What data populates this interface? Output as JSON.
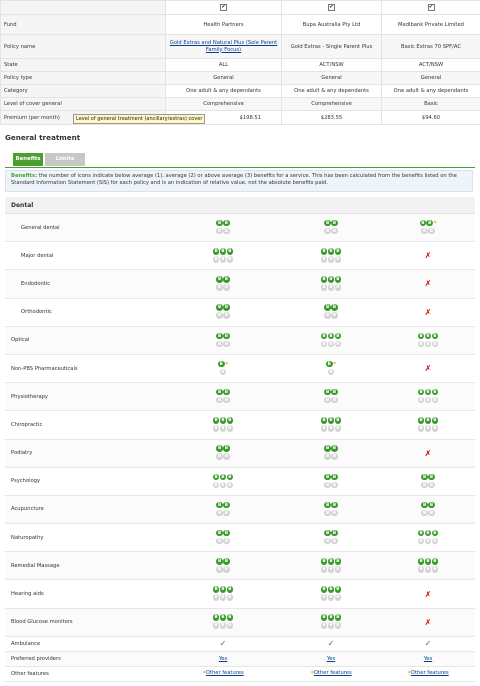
{
  "compare": {
    "select_marks": [
      "✔",
      "✔",
      "✔"
    ],
    "rows": [
      {
        "label": "Fund",
        "values": [
          "Health Partners",
          "Bupa Australia Pty Ltd",
          "Medibank Private Limited"
        ]
      },
      {
        "label": "Policy name",
        "values": [
          "Gold Extras and Natural Plus (Sole Parent Family Focus)",
          "Gold Extras - Single Parent Plus",
          "Basic Extras 70 SPF/AC"
        ]
      },
      {
        "label": "State",
        "values": [
          "ALL",
          "ACT/NSW",
          "ACT/NSW"
        ]
      },
      {
        "label": "Policy type",
        "values": [
          "General",
          "General",
          "General"
        ]
      },
      {
        "label": "Category",
        "values": [
          "One adult & any dependants",
          "One adult & any dependants",
          "One adult & any dependants"
        ]
      },
      {
        "label": "Level of cover general",
        "values": [
          "Comprehensive",
          "Comprehensive",
          "Basic"
        ]
      },
      {
        "label": "Premium (per month)",
        "values": [
          "$198.51",
          "$283.55",
          "$94.60"
        ]
      }
    ]
  },
  "tooltip": "Level of general treatment (ancillary/extras) cover",
  "section_title": "General treatment",
  "tabs": {
    "benefits": "Benefits",
    "limits": "Limits"
  },
  "info": {
    "label": "Benefits:",
    "text": " the number of icons indicate below average (1), average (2) or above average (3) benefits for a service. This has been calculated from the benefits listed on the Standard Information Statement (SIS) for each policy and is an indication of relative value, not the absolute benefits paid."
  },
  "dental_heading": "Dental",
  "icon_letter": "B",
  "cross_symbol": "✗",
  "tick_symbol": "✓",
  "star_symbol": "*",
  "services": [
    {
      "name": "General dental",
      "indent": true,
      "cells": [
        {
          "n": 2
        },
        {
          "n": 2
        },
        {
          "n": 2,
          "star": true
        }
      ]
    },
    {
      "name": "Major dental",
      "indent": true,
      "cells": [
        {
          "n": 3
        },
        {
          "n": 3
        },
        {
          "x": true
        }
      ]
    },
    {
      "name": "Endodontic",
      "indent": true,
      "cells": [
        {
          "n": 2
        },
        {
          "n": 3
        },
        {
          "x": true
        }
      ]
    },
    {
      "name": "Orthodontic",
      "indent": true,
      "cells": [
        {
          "n": 2
        },
        {
          "n": 2
        },
        {
          "x": true
        }
      ]
    },
    {
      "name": "Optical",
      "indent": false,
      "cells": [
        {
          "n": 2
        },
        {
          "n": 3
        },
        {
          "n": 3
        }
      ]
    },
    {
      "name": "Non-PBS Pharmaceuticals",
      "indent": false,
      "cells": [
        {
          "n": 1,
          "star": true
        },
        {
          "n": 1,
          "star": true
        },
        {
          "x": true
        }
      ]
    },
    {
      "name": "Physiotherapy",
      "indent": false,
      "cells": [
        {
          "n": 2
        },
        {
          "n": 2
        },
        {
          "n": 3
        }
      ]
    },
    {
      "name": "Chiropractic",
      "indent": false,
      "cells": [
        {
          "n": 3
        },
        {
          "n": 3
        },
        {
          "n": 3
        }
      ]
    },
    {
      "name": "Podiatry",
      "indent": false,
      "cells": [
        {
          "n": 2
        },
        {
          "n": 2
        },
        {
          "x": true
        }
      ]
    },
    {
      "name": "Psychology",
      "indent": false,
      "cells": [
        {
          "n": 3
        },
        {
          "n": 2
        },
        {
          "n": 2
        }
      ]
    },
    {
      "name": "Acupuncture",
      "indent": false,
      "cells": [
        {
          "n": 2
        },
        {
          "n": 2
        },
        {
          "n": 2
        }
      ]
    },
    {
      "name": "Naturopathy",
      "indent": false,
      "cells": [
        {
          "n": 2
        },
        {
          "n": 2
        },
        {
          "n": 3
        }
      ]
    },
    {
      "name": "Remedial Massage",
      "indent": false,
      "cells": [
        {
          "n": 2
        },
        {
          "n": 3
        },
        {
          "n": 3
        }
      ]
    },
    {
      "name": "Hearing aids",
      "indent": false,
      "cells": [
        {
          "n": 3
        },
        {
          "n": 3
        },
        {
          "x": true
        }
      ]
    },
    {
      "name": "Blood Glucose monitors",
      "indent": false,
      "cells": [
        {
          "n": 3
        },
        {
          "n": 3
        },
        {
          "x": true
        }
      ]
    }
  ],
  "ambulance": {
    "label": "Ambulance",
    "values": [
      "tick",
      "tick",
      "tick"
    ]
  },
  "preferred": {
    "label": "Preferred providers",
    "values": [
      "Yes",
      "Yes",
      "Yes"
    ]
  },
  "other": {
    "label": "Other features",
    "values": [
      "Other features",
      "Other features",
      "Other features"
    ]
  }
}
